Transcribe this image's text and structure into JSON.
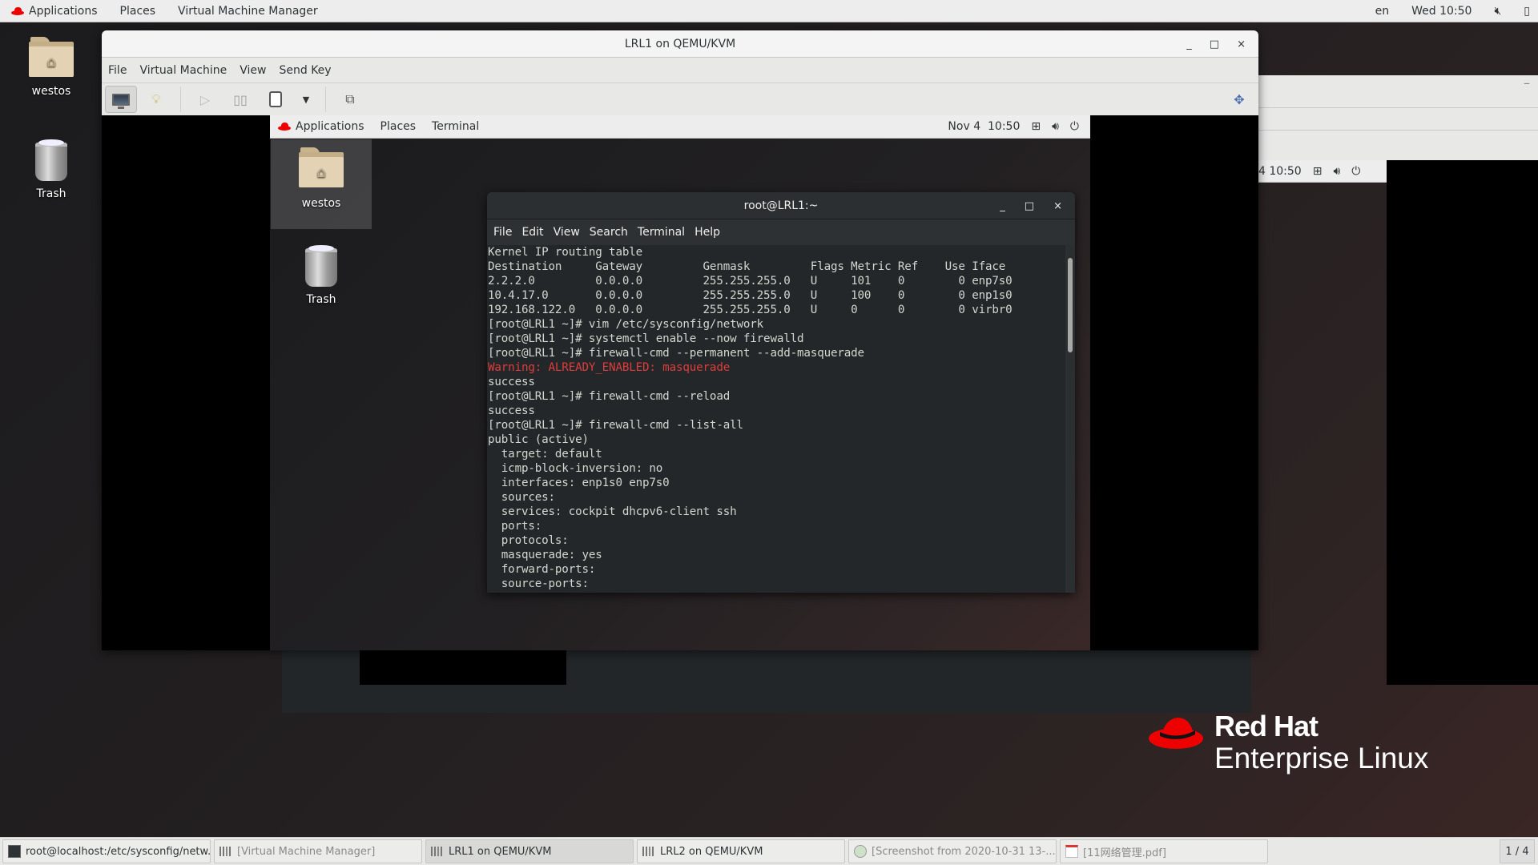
{
  "host_topbar": {
    "applications": "Applications",
    "places": "Places",
    "active_app": "Virtual Machine Manager",
    "language": "en",
    "clock": "Wed 10:50",
    "icons": [
      "volume-muted-icon",
      "battery-icon"
    ]
  },
  "host_desktop": {
    "icons": [
      {
        "label": "westos",
        "icon": "home-folder-icon"
      },
      {
        "label": "Trash",
        "icon": "trash-icon"
      }
    ]
  },
  "vm_window": {
    "title": "LRL1 on QEMU/KVM",
    "controls": {
      "minimize": "_",
      "maximize": "□",
      "close": "×"
    },
    "menu": [
      "File",
      "Virtual Machine",
      "View",
      "Send Key"
    ],
    "toolbar": [
      {
        "name": "console-view",
        "icon": "monitor-icon",
        "active": true
      },
      {
        "name": "details-view",
        "icon": "lightbulb-icon"
      },
      {
        "name": "run",
        "icon": "play-icon",
        "disabled": true
      },
      {
        "name": "pause",
        "icon": "pause-icon"
      },
      {
        "name": "shutdown",
        "icon": "power-switch-icon"
      },
      {
        "name": "shutdown-menu",
        "icon": "dropdown-arrow-icon"
      },
      {
        "name": "snapshots",
        "icon": "snapshots-icon"
      },
      {
        "name": "fullscreen",
        "icon": "resize-icon"
      }
    ]
  },
  "guest": {
    "topbar": {
      "applications": "Applications",
      "places": "Places",
      "active_app": "Terminal",
      "clock": "Nov 4  10:50",
      "icons": [
        "network-icon",
        "volume-icon",
        "power-icon"
      ]
    },
    "desktop_icons": [
      {
        "label": "westos",
        "icon": "home-folder-icon",
        "selected": true
      },
      {
        "label": "Trash",
        "icon": "trash-icon"
      }
    ],
    "terminal": {
      "title": "root@LRL1:~",
      "menu": [
        "File",
        "Edit",
        "View",
        "Search",
        "Terminal",
        "Help"
      ],
      "lines": [
        {
          "text": "Kernel IP routing table"
        },
        {
          "text": "Destination     Gateway         Genmask         Flags Metric Ref    Use Iface"
        },
        {
          "text": "2.2.2.0         0.0.0.0         255.255.255.0   U     101    0        0 enp7s0"
        },
        {
          "text": "10.4.17.0       0.0.0.0         255.255.255.0   U     100    0        0 enp1s0"
        },
        {
          "text": "192.168.122.0   0.0.0.0         255.255.255.0   U     0      0        0 virbr0"
        },
        {
          "text": "[root@LRL1 ~]# vim /etc/sysconfig/network"
        },
        {
          "text": "[root@LRL1 ~]# systemctl enable --now firewalld"
        },
        {
          "text": "[root@LRL1 ~]# firewall-cmd --permanent --add-masquerade"
        },
        {
          "text": "Warning: ALREADY_ENABLED: masquerade",
          "type": "warning"
        },
        {
          "text": "success"
        },
        {
          "text": "[root@LRL1 ~]# firewall-cmd --reload"
        },
        {
          "text": "success"
        },
        {
          "text": "[root@LRL1 ~]# firewall-cmd --list-all"
        },
        {
          "text": "public (active)"
        },
        {
          "text": "  target: default"
        },
        {
          "text": "  icmp-block-inversion: no"
        },
        {
          "text": "  interfaces: enp1s0 enp7s0"
        },
        {
          "text": "  sources: "
        },
        {
          "text": "  services: cockpit dhcpv6-client ssh"
        },
        {
          "text": "  ports: "
        },
        {
          "text": "  protocols: "
        },
        {
          "text": "  masquerade: yes"
        },
        {
          "text": "  forward-ports: "
        },
        {
          "text": "  source-ports: "
        }
      ],
      "colors": {
        "warning": "#e03c3c",
        "text": "#d3d7cf",
        "background": "#232729"
      }
    }
  },
  "background_window": {
    "guest_clock_partial": "4  10:50"
  },
  "branding": {
    "name": "Red Hat",
    "product": "Enterprise Linux",
    "color": "#ee0000"
  },
  "taskbar": {
    "tasks": [
      {
        "label": "root@localhost:/etc/sysconfig/netw...",
        "icon": "terminal-icon",
        "state": "normal"
      },
      {
        "label": "[Virtual Machine Manager]",
        "icon": "virt-manager-icon",
        "state": "minimized"
      },
      {
        "label": "LRL1 on QEMU/KVM",
        "icon": "virt-manager-icon",
        "state": "active"
      },
      {
        "label": "LRL2 on QEMU/KVM",
        "icon": "virt-manager-icon",
        "state": "normal"
      },
      {
        "label": "[Screenshot from 2020-10-31 13-...",
        "icon": "image-viewer-icon",
        "state": "minimized"
      },
      {
        "label": "[11网络管理.pdf]",
        "icon": "pdf-icon",
        "state": "minimized"
      }
    ],
    "workspace": "1 / 4"
  }
}
